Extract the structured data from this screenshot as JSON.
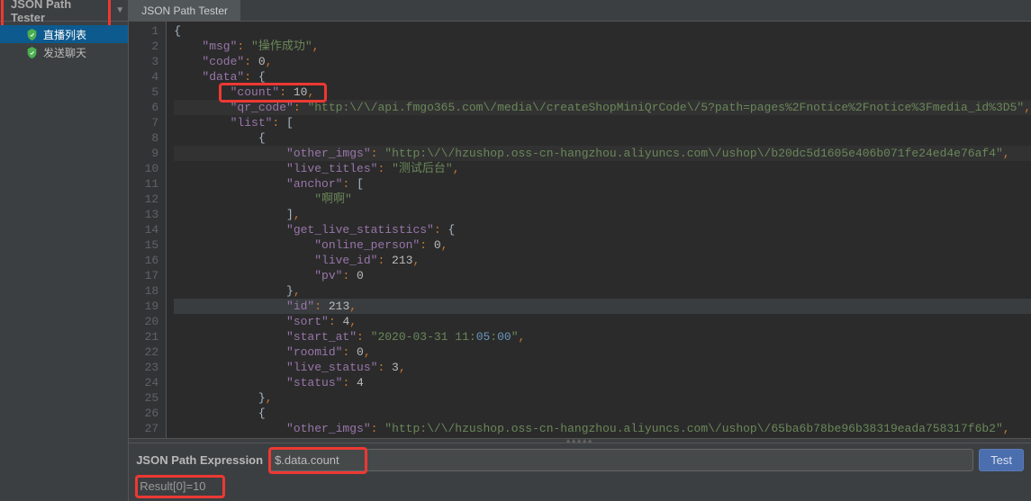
{
  "sidebar": {
    "title": "JSON Path Tester",
    "items": [
      {
        "label": "直播列表",
        "selected": true
      },
      {
        "label": "发送聊天",
        "selected": false
      }
    ]
  },
  "tab": {
    "label": "JSON Path Tester"
  },
  "code": {
    "lines": [
      "{",
      "    \"msg\": \"操作成功\",",
      "    \"code\": 0,",
      "    \"data\": {",
      "        \"count\": 10,",
      "        \"qr_code\": \"http:\\/\\/api.fmgo365.com\\/media\\/createShopMiniQrCode\\/5?path=pages%2Fnotice%2Fnotice%3Fmedia_id%3D5\",",
      "        \"list\": [",
      "            {",
      "                \"other_imgs\": \"http:\\/\\/hzushop.oss-cn-hangzhou.aliyuncs.com\\/ushop\\/b20dc5d1605e406b071fe24ed4e76af4\",",
      "                \"live_titles\": \"测试后台\",",
      "                \"anchor\": [",
      "                    \"啊啊\"",
      "                ],",
      "                \"get_live_statistics\": {",
      "                    \"online_person\": 0,",
      "                    \"live_id\": 213,",
      "                    \"pv\": 0",
      "                },",
      "                \"id\": 213,",
      "                \"sort\": 4,",
      "                \"start_at\": \"2020-03-31 11:05:00\",",
      "                \"roomid\": 0,",
      "                \"live_status\": 3,",
      "                \"status\": 4",
      "            },",
      "            {",
      "                \"other_imgs\": \"http:\\/\\/hzushop.oss-cn-hangzhou.aliyuncs.com\\/ushop\\/65ba6b78be96b38319eada758317f6b2\","
    ]
  },
  "expression": {
    "label": "JSON Path Expression",
    "value": "$.data.count"
  },
  "test_button": "Test",
  "result": "Result[0]=10",
  "colors": {
    "highlight": "#ed3833",
    "bg_dark": "#2b2b2b",
    "bg_panel": "#3c3f41"
  }
}
